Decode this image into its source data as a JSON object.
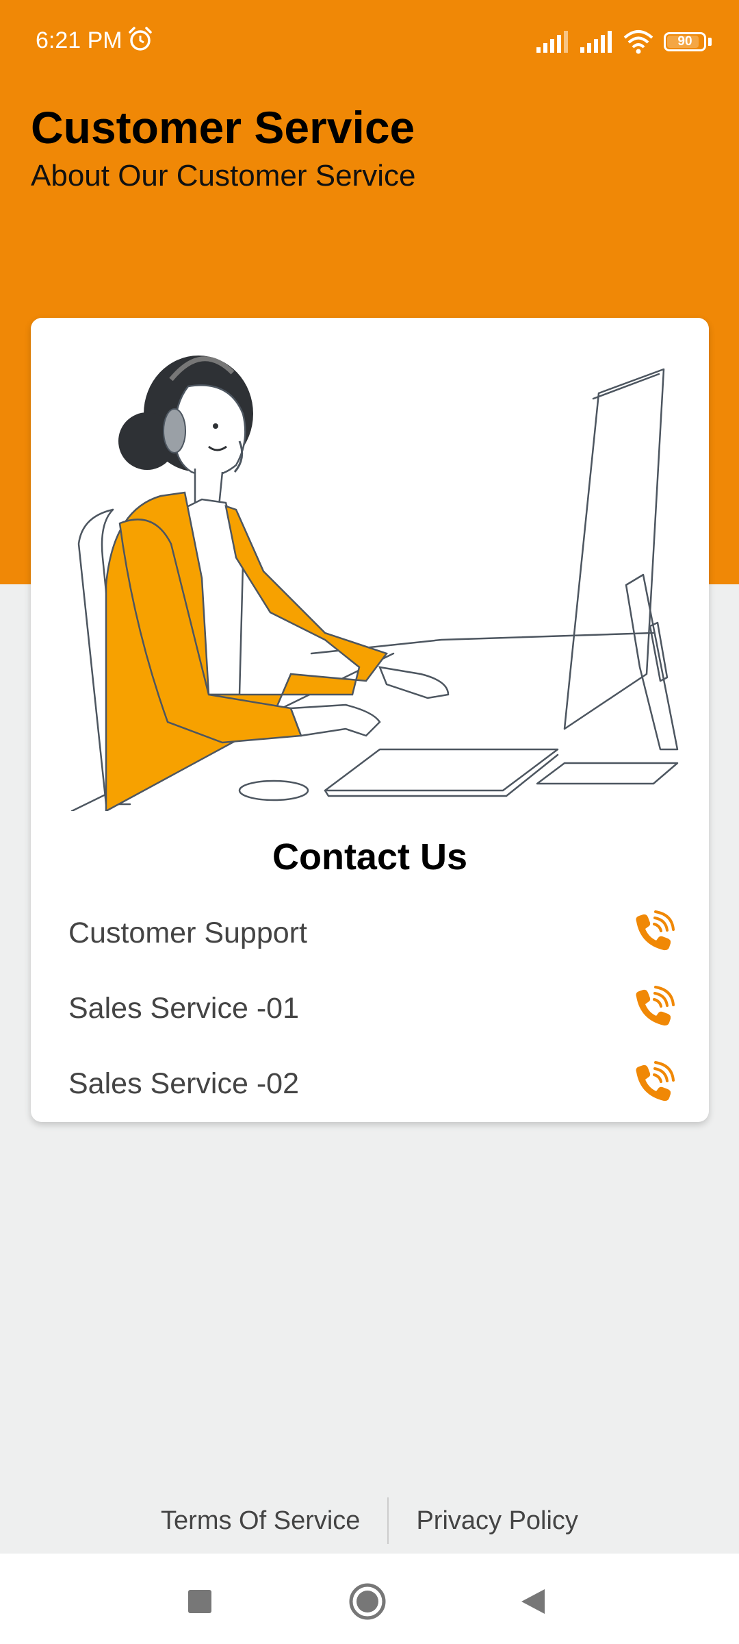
{
  "status_bar": {
    "time": "6:21 PM",
    "battery_level": "90",
    "battery_fraction": 0.9,
    "icons": [
      "alarm-icon",
      "signal-icon",
      "signal-icon",
      "wifi-icon",
      "battery-icon"
    ]
  },
  "header": {
    "title": "Customer Service",
    "subtitle": "About Our Customer Service",
    "background_color": "#f08806"
  },
  "card": {
    "illustration": "customer-service-agent-illustration",
    "contact_title": "Contact Us",
    "contacts": [
      {
        "label": "Customer Support",
        "icon": "phone-call-icon"
      },
      {
        "label": "Sales Service -01",
        "icon": "phone-call-icon"
      },
      {
        "label": "Sales Service -02",
        "icon": "phone-call-icon"
      }
    ],
    "accent_color": "#f08806"
  },
  "footer": {
    "terms_label": "Terms Of Service",
    "privacy_label": "Privacy Policy"
  },
  "nav_bar": {
    "buttons": [
      "recents-square-icon",
      "home-circle-icon",
      "back-triangle-icon"
    ]
  }
}
